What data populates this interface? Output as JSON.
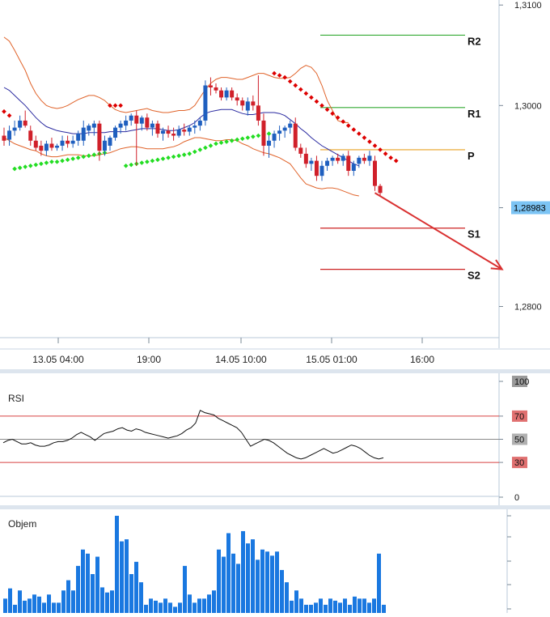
{
  "colors": {
    "bull": "#1f5fbf",
    "bear": "#d0202a",
    "bb": "#e0632a",
    "ma": "#2a2aa0",
    "sar_bull": "#22dd22",
    "sar_bear": "#dd0000",
    "pivot_p": "#e8a020",
    "pivot_r": "#33aa33",
    "pivot_s": "#cc2222",
    "arrow": "#d93030",
    "grid": "#b8c8d8",
    "price_tag": "#7cc4f4",
    "rsi_level": "#d84040",
    "volume": "#1a78e0"
  },
  "chart_data": [
    {
      "type": "candlestick",
      "title": "",
      "x_tick_labels": [
        "13.05 04:00",
        "19:00",
        "14.05 10:00",
        "15.05 01:00",
        "16:00"
      ],
      "y_tick_labels": [
        "1,3100",
        "1,3000",
        "1,2800"
      ],
      "y_ticks": [
        1.31,
        1.3,
        1.28
      ],
      "ylim": [
        1.2769,
        1.3105
      ],
      "current_price": 1.28983,
      "current_price_label": "1,28983",
      "pivots": [
        {
          "label": "R2",
          "value": 1.307,
          "level": "r"
        },
        {
          "label": "R1",
          "value": 1.2998,
          "level": "r"
        },
        {
          "label": "P",
          "value": 1.2956,
          "level": "p"
        },
        {
          "label": "S1",
          "value": 1.2878,
          "level": "s"
        },
        {
          "label": "S2",
          "value": 1.2837,
          "level": "s"
        }
      ],
      "candles": [
        {
          "o": 1.297,
          "h": 1.2978,
          "l": 1.296,
          "c": 1.2965
        },
        {
          "o": 1.2966,
          "h": 1.298,
          "l": 1.296,
          "c": 1.2975
        },
        {
          "o": 1.2975,
          "h": 1.2985,
          "l": 1.297,
          "c": 1.2978
        },
        {
          "o": 1.2978,
          "h": 1.299,
          "l": 1.2975,
          "c": 1.2985
        },
        {
          "o": 1.2985,
          "h": 1.2995,
          "l": 1.2978,
          "c": 1.298
        },
        {
          "o": 1.2975,
          "h": 1.298,
          "l": 1.296,
          "c": 1.2965
        },
        {
          "o": 1.2965,
          "h": 1.297,
          "l": 1.2955,
          "c": 1.2958
        },
        {
          "o": 1.296,
          "h": 1.2965,
          "l": 1.295,
          "c": 1.2955
        },
        {
          "o": 1.2955,
          "h": 1.2965,
          "l": 1.295,
          "c": 1.2962
        },
        {
          "o": 1.2962,
          "h": 1.2968,
          "l": 1.2955,
          "c": 1.2958
        },
        {
          "o": 1.2958,
          "h": 1.2962,
          "l": 1.2955,
          "c": 1.296
        },
        {
          "o": 1.296,
          "h": 1.297,
          "l": 1.2955,
          "c": 1.2965
        },
        {
          "o": 1.2965,
          "h": 1.297,
          "l": 1.2958,
          "c": 1.2962
        },
        {
          "o": 1.2962,
          "h": 1.297,
          "l": 1.2958,
          "c": 1.2965
        },
        {
          "o": 1.2965,
          "h": 1.2975,
          "l": 1.296,
          "c": 1.2972
        },
        {
          "o": 1.2965,
          "h": 1.2985,
          "l": 1.296,
          "c": 1.2978
        },
        {
          "o": 1.2975,
          "h": 1.2982,
          "l": 1.297,
          "c": 1.298
        },
        {
          "o": 1.2978,
          "h": 1.2985,
          "l": 1.297,
          "c": 1.2982
        },
        {
          "o": 1.2982,
          "h": 1.2985,
          "l": 1.2945,
          "c": 1.2955
        },
        {
          "o": 1.2955,
          "h": 1.297,
          "l": 1.295,
          "c": 1.2965
        },
        {
          "o": 1.296,
          "h": 1.297,
          "l": 1.2955,
          "c": 1.2968
        },
        {
          "o": 1.2968,
          "h": 1.298,
          "l": 1.2965,
          "c": 1.2978
        },
        {
          "o": 1.2978,
          "h": 1.2985,
          "l": 1.2972,
          "c": 1.2982
        },
        {
          "o": 1.298,
          "h": 1.299,
          "l": 1.2975,
          "c": 1.2985
        },
        {
          "o": 1.2985,
          "h": 1.2992,
          "l": 1.298,
          "c": 1.299
        },
        {
          "o": 1.299,
          "h": 1.2995,
          "l": 1.294,
          "c": 1.2982
        },
        {
          "o": 1.2982,
          "h": 1.299,
          "l": 1.2975,
          "c": 1.2988
        },
        {
          "o": 1.2988,
          "h": 1.2992,
          "l": 1.2975,
          "c": 1.2978
        },
        {
          "o": 1.2978,
          "h": 1.2985,
          "l": 1.297,
          "c": 1.2982
        },
        {
          "o": 1.2982,
          "h": 1.2985,
          "l": 1.2968,
          "c": 1.2972
        },
        {
          "o": 1.2972,
          "h": 1.2978,
          "l": 1.2965,
          "c": 1.2975
        },
        {
          "o": 1.2975,
          "h": 1.298,
          "l": 1.2968,
          "c": 1.2972
        },
        {
          "o": 1.2972,
          "h": 1.2978,
          "l": 1.2965,
          "c": 1.297
        },
        {
          "o": 1.297,
          "h": 1.298,
          "l": 1.2968,
          "c": 1.2976
        },
        {
          "o": 1.2976,
          "h": 1.2982,
          "l": 1.297,
          "c": 1.2974
        },
        {
          "o": 1.2974,
          "h": 1.298,
          "l": 1.297,
          "c": 1.2978
        },
        {
          "o": 1.2978,
          "h": 1.2985,
          "l": 1.2972,
          "c": 1.298
        },
        {
          "o": 1.298,
          "h": 1.2988,
          "l": 1.2975,
          "c": 1.2985
        },
        {
          "o": 1.2985,
          "h": 1.3025,
          "l": 1.298,
          "c": 1.302
        },
        {
          "o": 1.302,
          "h": 1.3028,
          "l": 1.301,
          "c": 1.3018
        },
        {
          "o": 1.3018,
          "h": 1.3022,
          "l": 1.3012,
          "c": 1.3015
        },
        {
          "o": 1.3015,
          "h": 1.3018,
          "l": 1.3005,
          "c": 1.3008
        },
        {
          "o": 1.3008,
          "h": 1.3018,
          "l": 1.3005,
          "c": 1.3015
        },
        {
          "o": 1.3015,
          "h": 1.3018,
          "l": 1.3005,
          "c": 1.3008
        },
        {
          "o": 1.3008,
          "h": 1.3012,
          "l": 1.3,
          "c": 1.3005
        },
        {
          "o": 1.3005,
          "h": 1.3008,
          "l": 1.2995,
          "c": 1.3
        },
        {
          "o": 1.2995,
          "h": 1.3008,
          "l": 1.299,
          "c": 1.3004
        },
        {
          "o": 1.3004,
          "h": 1.301,
          "l": 1.2995,
          "c": 1.3
        },
        {
          "o": 1.3,
          "h": 1.303,
          "l": 1.298,
          "c": 1.2985
        },
        {
          "o": 1.2985,
          "h": 1.2992,
          "l": 1.295,
          "c": 1.296
        },
        {
          "o": 1.296,
          "h": 1.297,
          "l": 1.2948,
          "c": 1.2965
        },
        {
          "o": 1.2965,
          "h": 1.2975,
          "l": 1.2958,
          "c": 1.2972
        },
        {
          "o": 1.2972,
          "h": 1.298,
          "l": 1.2965,
          "c": 1.2975
        },
        {
          "o": 1.2975,
          "h": 1.298,
          "l": 1.2968,
          "c": 1.2978
        },
        {
          "o": 1.2978,
          "h": 1.2985,
          "l": 1.2972,
          "c": 1.2982
        },
        {
          "o": 1.2982,
          "h": 1.2988,
          "l": 1.2955,
          "c": 1.2958
        },
        {
          "o": 1.2958,
          "h": 1.2962,
          "l": 1.2948,
          "c": 1.2952
        },
        {
          "o": 1.2952,
          "h": 1.2958,
          "l": 1.2938,
          "c": 1.2942
        },
        {
          "o": 1.2942,
          "h": 1.2948,
          "l": 1.2935,
          "c": 1.2945
        },
        {
          "o": 1.2945,
          "h": 1.295,
          "l": 1.2925,
          "c": 1.293
        },
        {
          "o": 1.293,
          "h": 1.2945,
          "l": 1.2925,
          "c": 1.294
        },
        {
          "o": 1.294,
          "h": 1.2948,
          "l": 1.2935,
          "c": 1.2945
        },
        {
          "o": 1.2945,
          "h": 1.295,
          "l": 1.294,
          "c": 1.2948
        },
        {
          "o": 1.2948,
          "h": 1.2952,
          "l": 1.2942,
          "c": 1.2945
        },
        {
          "o": 1.2945,
          "h": 1.2952,
          "l": 1.294,
          "c": 1.295
        },
        {
          "o": 1.295,
          "h": 1.2955,
          "l": 1.293,
          "c": 1.2935
        },
        {
          "o": 1.2935,
          "h": 1.2945,
          "l": 1.293,
          "c": 1.2942
        },
        {
          "o": 1.2942,
          "h": 1.295,
          "l": 1.2938,
          "c": 1.2948
        },
        {
          "o": 1.2948,
          "h": 1.2952,
          "l": 1.2942,
          "c": 1.2945
        },
        {
          "o": 1.2945,
          "h": 1.2955,
          "l": 1.294,
          "c": 1.295
        },
        {
          "o": 1.2945,
          "h": 1.295,
          "l": 1.2915,
          "c": 1.292
        },
        {
          "o": 1.292,
          "h": 1.2922,
          "l": 1.291,
          "c": 1.2913
        }
      ],
      "bollinger": {
        "upper": [
          1.3068,
          1.3064,
          1.3055,
          1.3045,
          1.3035,
          1.3022,
          1.3012,
          1.3005,
          1.3,
          1.2998,
          1.2997,
          1.2998,
          1.3,
          1.3003,
          1.3006,
          1.3008,
          1.301,
          1.301,
          1.3008,
          1.3005,
          1.3,
          1.2996,
          1.2994,
          1.2993,
          1.2994,
          1.2995,
          1.2996,
          1.2997,
          1.2995,
          1.2994,
          1.2993,
          1.2993,
          1.2994,
          1.2995,
          1.2995,
          1.2996,
          1.3,
          1.3008,
          1.3016,
          1.3022,
          1.3026,
          1.3028,
          1.3028,
          1.3027,
          1.3026,
          1.3026,
          1.3028,
          1.303,
          1.3032,
          1.3032,
          1.303,
          1.3028,
          1.3027,
          1.3027,
          1.3028,
          1.3032,
          1.3037,
          1.304,
          1.3038,
          1.3032,
          1.302,
          1.3005,
          1.2995,
          1.2985,
          1.2983,
          1.2983
        ],
        "middle": [
          1.3018,
          1.3015,
          1.301,
          1.3005,
          1.3,
          1.2994,
          1.2988,
          1.2983,
          1.2979,
          1.2977,
          1.2975,
          1.2974,
          1.2973,
          1.2972,
          1.2972,
          1.2972,
          1.2973,
          1.2973,
          1.2973,
          1.2973,
          1.2974,
          1.2974,
          1.2974,
          1.2974,
          1.2975,
          1.2976,
          1.2977,
          1.2977,
          1.2977,
          1.2977,
          1.2976,
          1.2975,
          1.2975,
          1.2976,
          1.2978,
          1.298,
          1.2983,
          1.2988,
          1.2992,
          1.2994,
          1.2995,
          1.2996,
          1.2996,
          1.2996,
          1.2994,
          1.2992,
          1.2991,
          1.2991,
          1.2992,
          1.2993,
          1.2993,
          1.2993,
          1.2992,
          1.299,
          1.2986,
          1.2982,
          1.2977,
          1.2973,
          1.2968,
          1.2964,
          1.296,
          1.2957,
          1.2954,
          1.2951,
          1.2948,
          1.2945,
          1.2942,
          1.294
        ],
        "lower": [
          1.2968,
          1.2965,
          1.2962,
          1.296,
          1.2958,
          1.2956,
          1.2955,
          1.2952,
          1.295,
          1.2949,
          1.2949,
          1.295,
          1.2951,
          1.2951,
          1.2951,
          1.295,
          1.295,
          1.295,
          1.2951,
          1.2952,
          1.2953,
          1.2955,
          1.2957,
          1.2958,
          1.2959,
          1.2959,
          1.2958,
          1.2957,
          1.2957,
          1.2957,
          1.2957,
          1.2958,
          1.2959,
          1.2961,
          1.2964,
          1.2966,
          1.2968,
          1.2968,
          1.2967,
          1.2966,
          1.2965,
          1.2965,
          1.2966,
          1.2966,
          1.2965,
          1.2962,
          1.296,
          1.2957,
          1.2955,
          1.2953,
          1.2952,
          1.295,
          1.2948,
          1.2945,
          1.2942,
          1.2935,
          1.2928,
          1.2922,
          1.292,
          1.2918,
          1.2917,
          1.2918,
          1.2918,
          1.2917,
          1.2915,
          1.2913,
          1.2911,
          1.291
        ]
      },
      "sar": [
        {
          "trend": "bear",
          "values": [
            1.2994,
            1.299
          ]
        },
        {
          "trend": "bull",
          "values": [
            1.2937,
            1.2938,
            1.2939,
            1.294,
            1.2941,
            1.2942,
            1.2943,
            1.2944,
            1.2944,
            1.2945,
            1.2946,
            1.2947,
            1.2948,
            1.2949,
            1.295,
            1.2951,
            1.2952,
            1.2953
          ]
        },
        {
          "trend": "bear",
          "values": [
            1.3,
            1.3,
            1.3
          ]
        },
        {
          "trend": "bull",
          "values": [
            1.294,
            1.2941,
            1.2942,
            1.2943,
            1.2944,
            1.2945,
            1.2946,
            1.2947,
            1.2948,
            1.2949,
            1.295,
            1.2951,
            1.2952,
            1.2954,
            1.2956,
            1.2958,
            1.296,
            1.2962,
            1.2963,
            1.2964,
            1.2965,
            1.2966,
            1.2967,
            1.2968,
            1.2969,
            1.297,
            1.2971,
            1.2972
          ]
        },
        {
          "trend": "bear",
          "values": [
            1.3032,
            1.303,
            1.3028,
            1.3024,
            1.302,
            1.3016,
            1.3012,
            1.3008,
            1.3004,
            1.3,
            1.2996,
            1.2992,
            1.2988,
            1.2984,
            1.298,
            1.2976,
            1.2972,
            1.2968,
            1.2964,
            1.296,
            1.2956,
            1.2952,
            1.2948,
            1.2945
          ]
        }
      ],
      "projection": {
        "from": {
          "candle": 70,
          "value": 1.2913
        },
        "to": {
          "candle": 94,
          "value": 1.2837
        }
      }
    },
    {
      "type": "line",
      "title": "RSI",
      "y_tick_labels": [
        "100",
        "70",
        "50",
        "30",
        "0"
      ],
      "levels": [
        70,
        50,
        30
      ],
      "ylim": [
        0,
        100
      ],
      "values": [
        47,
        49,
        50,
        48,
        46,
        46,
        47,
        45,
        44,
        44,
        45,
        47,
        48,
        48,
        49,
        51,
        54,
        56,
        54,
        52,
        49,
        52,
        55,
        56,
        57,
        59,
        60,
        58,
        57,
        59,
        58,
        56,
        55,
        54,
        53,
        52,
        51,
        52,
        53,
        55,
        58,
        60,
        64,
        75,
        73,
        72,
        71,
        68,
        66,
        64,
        62,
        60,
        56,
        50,
        44,
        46,
        48,
        50,
        49,
        47,
        44,
        41,
        38,
        36,
        34,
        33,
        34,
        36,
        38,
        40,
        42,
        40,
        38,
        39,
        41,
        43,
        45,
        44,
        42,
        39,
        36,
        34,
        33,
        34
      ]
    },
    {
      "type": "bar",
      "title": "Objem",
      "values": [
        14,
        24,
        8,
        22,
        12,
        14,
        18,
        16,
        10,
        18,
        10,
        10,
        22,
        32,
        22,
        46,
        62,
        58,
        38,
        55,
        25,
        20,
        22,
        95,
        70,
        72,
        38,
        50,
        30,
        8,
        14,
        12,
        10,
        14,
        10,
        6,
        10,
        46,
        18,
        10,
        14,
        14,
        18,
        22,
        62,
        55,
        78,
        58,
        48,
        80,
        68,
        72,
        52,
        62,
        60,
        56,
        60,
        42,
        30,
        12,
        22,
        14,
        8,
        8,
        10,
        14,
        8,
        14,
        12,
        10,
        14,
        8,
        16,
        14,
        14,
        10,
        14,
        58,
        8
      ]
    }
  ]
}
